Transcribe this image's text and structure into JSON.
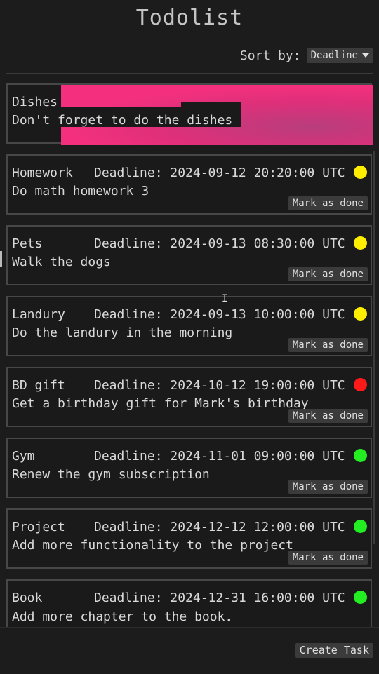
{
  "app": {
    "title": "Todolist"
  },
  "sort": {
    "label": "Sort by:",
    "selected": "Deadline"
  },
  "tasks": [
    {
      "name": "Dishes",
      "deadline": "",
      "description": "Don't forget to do the dishes",
      "status_color": "",
      "action": ""
    },
    {
      "name": "Homework",
      "deadline": "Deadline: 2024-09-12 20:20:00 UTC",
      "description": "Do math homework 3",
      "status_color": "#ffee00",
      "action": "Mark as done"
    },
    {
      "name": "Pets",
      "deadline": "Deadline: 2024-09-13 08:30:00 UTC",
      "description": "Walk the dogs",
      "status_color": "#ffee00",
      "action": "Mark as done"
    },
    {
      "name": "Landury",
      "deadline": "Deadline: 2024-09-13 10:00:00 UTC",
      "description": "Do the landury in the morning",
      "status_color": "#ffee00",
      "action": "Mark as done"
    },
    {
      "name": "BD gift",
      "deadline": "Deadline: 2024-10-12 19:00:00 UTC",
      "description": "Get a birthday gift for Mark's birthday",
      "status_color": "#ff1a1a",
      "action": "Mark as done"
    },
    {
      "name": "Gym",
      "deadline": "Deadline: 2024-11-01 09:00:00 UTC",
      "description": "Renew the gym subscription",
      "status_color": "#22ee22",
      "action": "Mark as done"
    },
    {
      "name": "Project",
      "deadline": "Deadline: 2024-12-12 12:00:00 UTC",
      "description": "Add more functionality to the project",
      "status_color": "#22ee22",
      "action": "Mark as done"
    },
    {
      "name": "Book",
      "deadline": "Deadline: 2024-12-31 16:00:00 UTC",
      "description": "Add more chapter to the book.\nKey points:",
      "status_color": "#22ee22",
      "action": ""
    }
  ],
  "footer": {
    "create_label": "Create Task"
  }
}
